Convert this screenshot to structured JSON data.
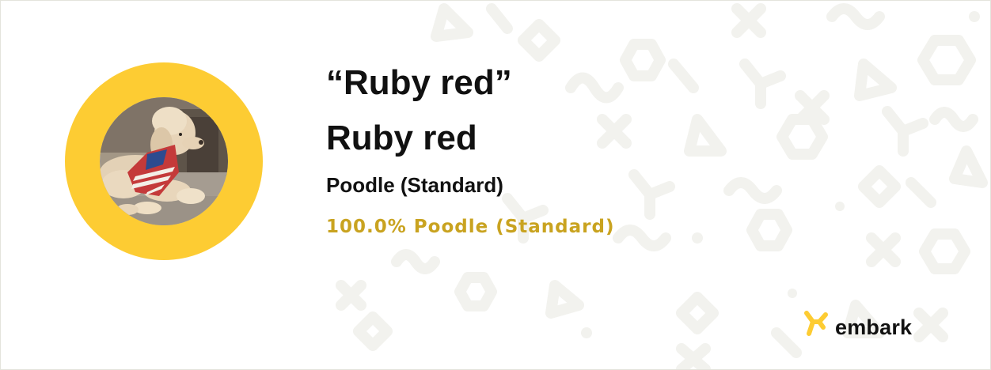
{
  "dog": {
    "nickname": "“Ruby red”",
    "name": "Ruby red",
    "breed": "Poodle (Standard)",
    "ancestry_summary": "100.0% Poodle (Standard)"
  },
  "brand": {
    "logo_text": "embark",
    "logo_icon": "embark-logo-icon"
  },
  "photo": {
    "subject": "dog-photo"
  },
  "colors": {
    "ring": "#fdcc33",
    "accent_text": "#c9a320",
    "primary_text": "#111111",
    "pattern": "#f3f3ef"
  }
}
